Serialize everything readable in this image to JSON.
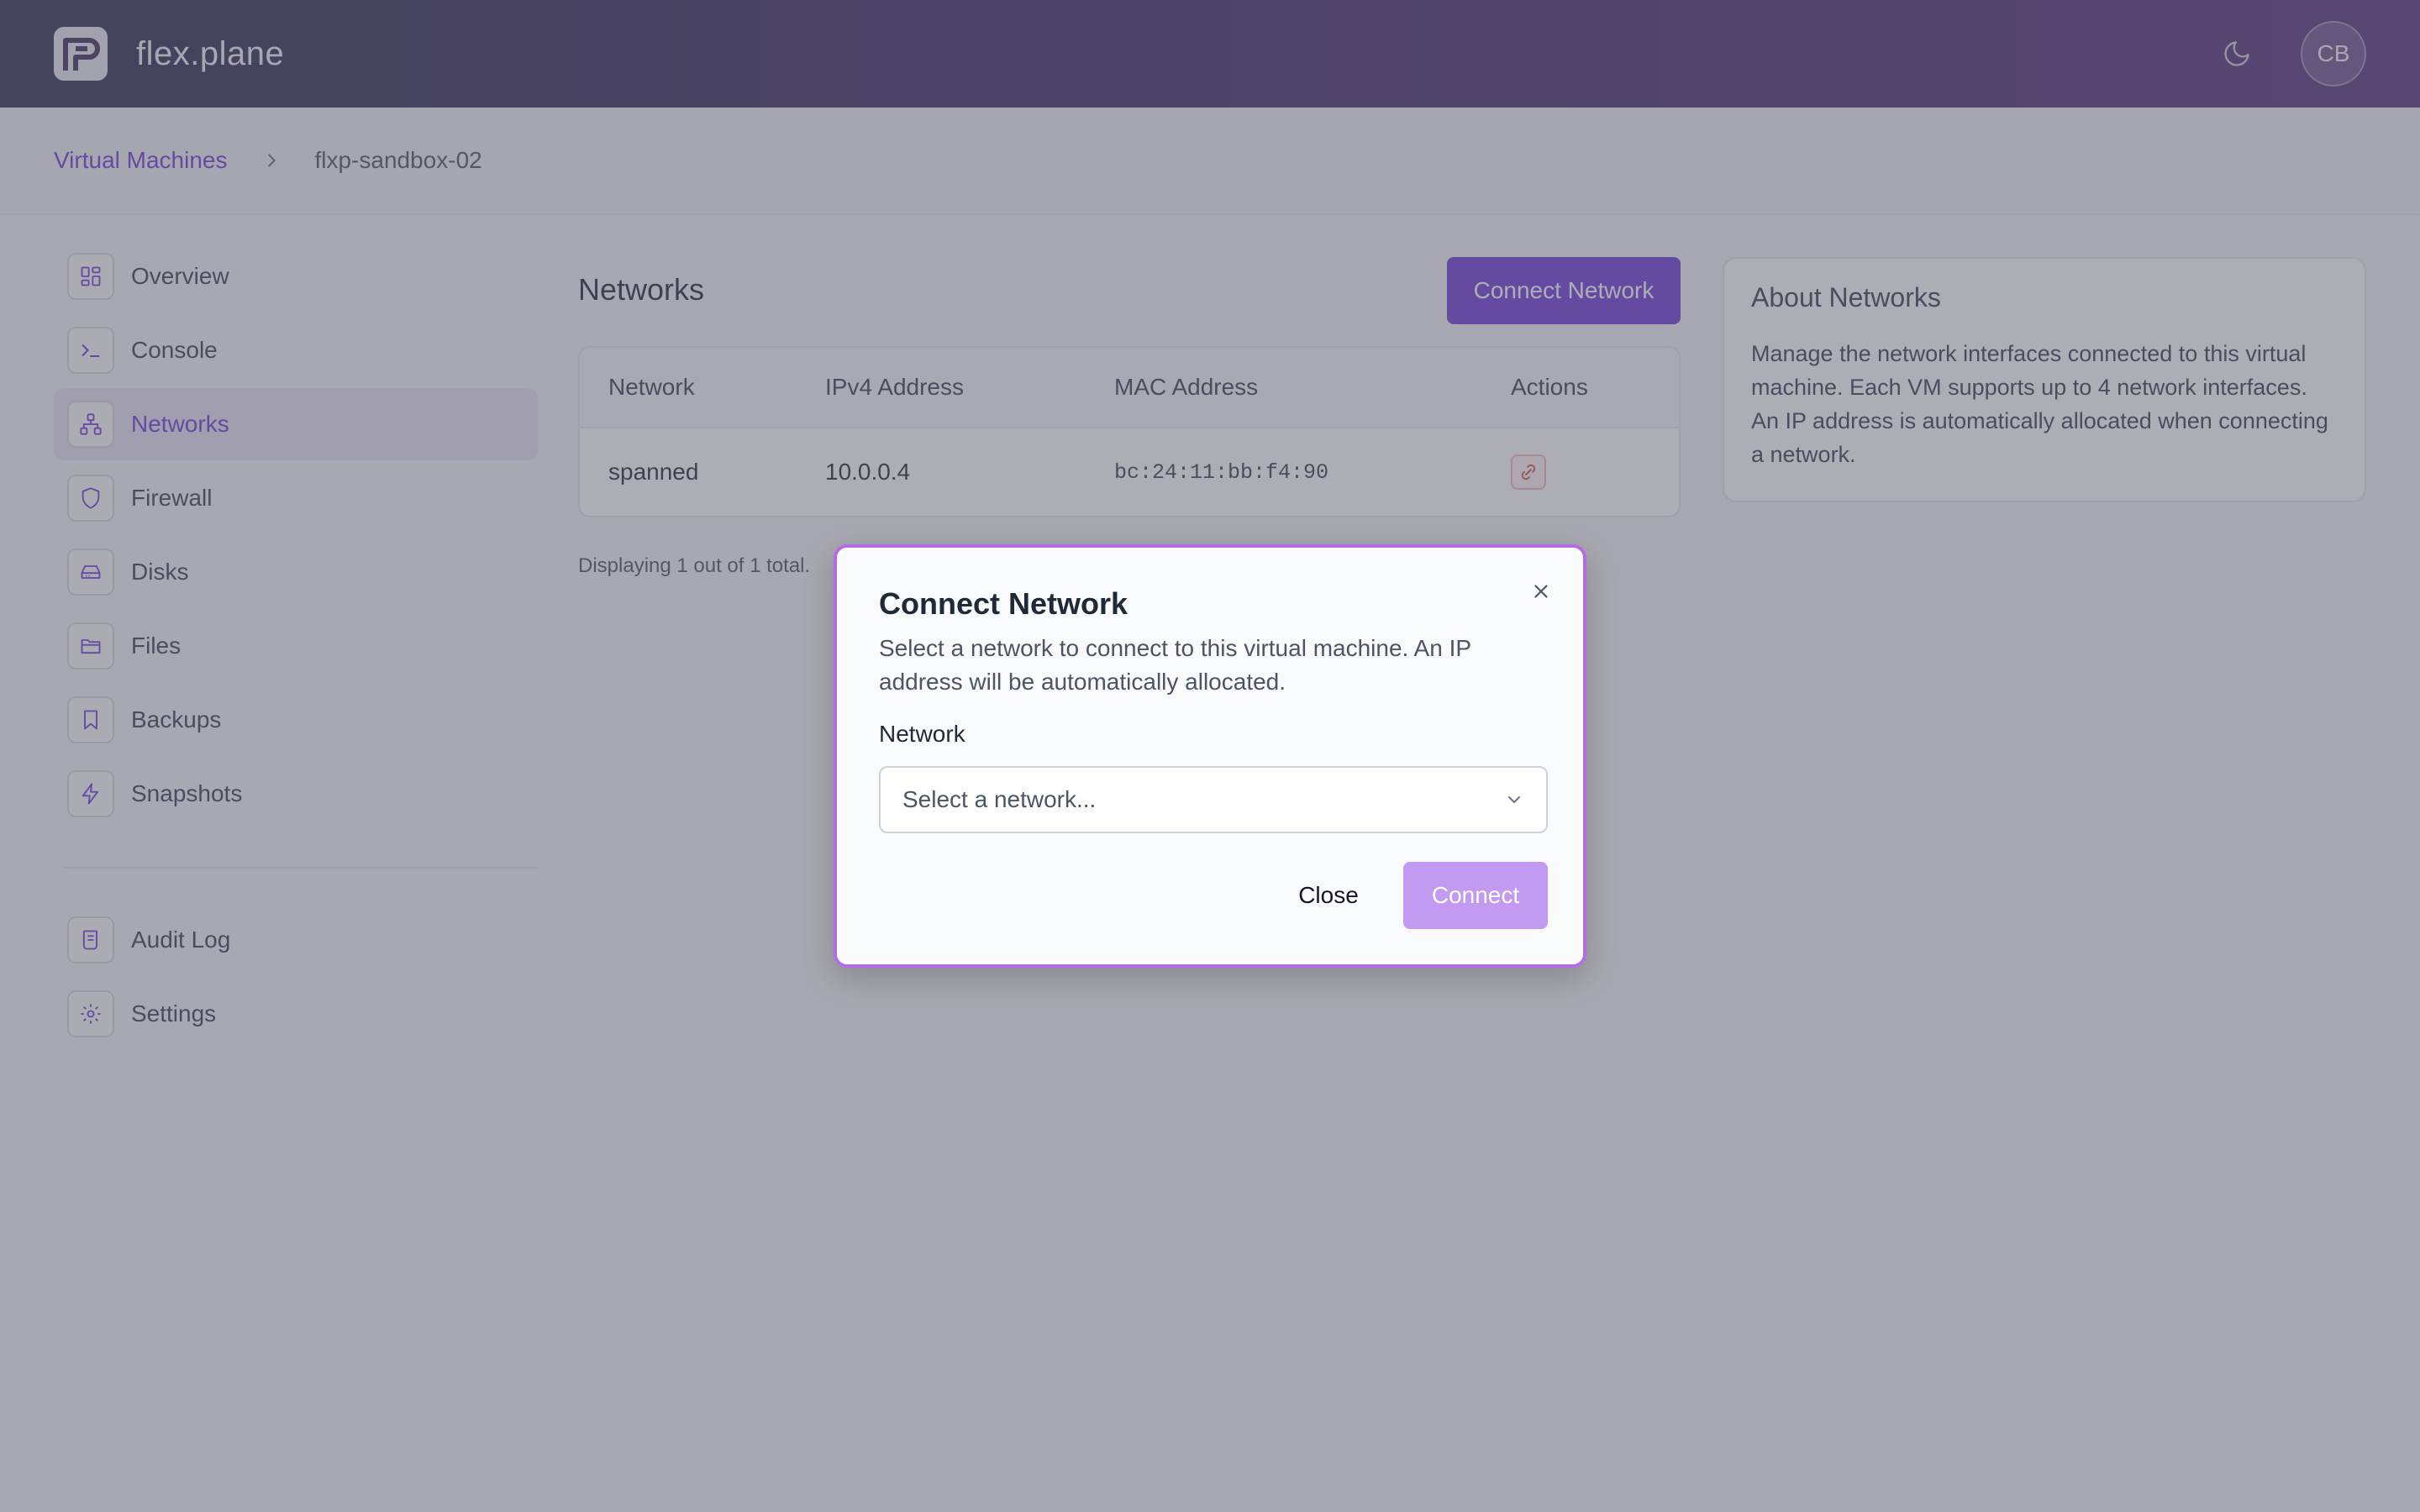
{
  "header": {
    "app_name": "flex.plane",
    "avatar_initials": "CB",
    "theme_icon": "moon-icon",
    "logo_icon": "flexplane-logo-icon"
  },
  "breadcrumb": {
    "parent": "Virtual Machines",
    "current": "flxp-sandbox-02"
  },
  "sidebar": {
    "items": [
      {
        "label": "Overview",
        "icon": "grid-icon",
        "active": false
      },
      {
        "label": "Console",
        "icon": "terminal-icon",
        "active": false
      },
      {
        "label": "Networks",
        "icon": "network-icon",
        "active": true
      },
      {
        "label": "Firewall",
        "icon": "shield-icon",
        "active": false
      },
      {
        "label": "Disks",
        "icon": "disk-icon",
        "active": false
      },
      {
        "label": "Files",
        "icon": "folder-icon",
        "active": false
      },
      {
        "label": "Backups",
        "icon": "bookmark-icon",
        "active": false
      },
      {
        "label": "Snapshots",
        "icon": "lightning-icon",
        "active": false
      }
    ],
    "secondary_items": [
      {
        "label": "Audit Log",
        "icon": "scroll-icon"
      },
      {
        "label": "Settings",
        "icon": "gear-icon"
      }
    ]
  },
  "main": {
    "title": "Networks",
    "connect_button": "Connect Network",
    "table": {
      "columns": [
        "Network",
        "IPv4 Address",
        "MAC Address",
        "Actions"
      ],
      "rows": [
        {
          "network": "spanned",
          "ipv4": "10.0.0.4",
          "mac": "bc:24:11:bb:f4:90",
          "action_icon": "disconnect-icon"
        }
      ]
    },
    "footer": "Displaying 1 out of 1 total."
  },
  "about": {
    "title": "About Networks",
    "text": "Manage the network interfaces connected to this virtual machine. Each VM supports up to 4 network interfaces. An IP address is automatically allocated when connecting a network."
  },
  "modal": {
    "title": "Connect Network",
    "description": "Select a network to connect to this virtual machine. An IP address will be automatically allocated.",
    "field_label": "Network",
    "select_placeholder": "Select a network...",
    "close_label": "Close",
    "connect_label": "Connect"
  },
  "colors": {
    "accent": "#6d3bd7",
    "accent_disabled": "#c39af1",
    "danger": "#e05252"
  }
}
